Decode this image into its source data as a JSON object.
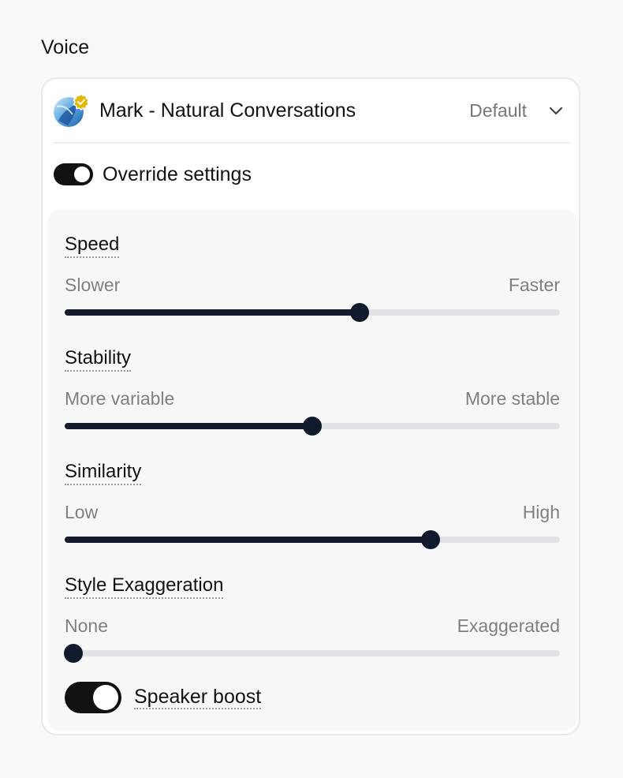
{
  "section": {
    "title": "Voice"
  },
  "voice": {
    "name": "Mark - Natural Conversations",
    "status": "Default",
    "avatar_icon": "voice-avatar-icon",
    "verified_icon": "verified-badge-icon",
    "dropdown_icon": "chevron-down-icon"
  },
  "override": {
    "label": "Override settings",
    "enabled": true
  },
  "sliders": [
    {
      "title": "Speed",
      "min_label": "Slower",
      "max_label": "Faster",
      "value": 0.596
    },
    {
      "title": "Stability",
      "min_label": "More variable",
      "max_label": "More stable",
      "value": 0.5
    },
    {
      "title": "Similarity",
      "min_label": "Low",
      "max_label": "High",
      "value": 0.739
    },
    {
      "title": "Style Exaggeration",
      "min_label": "None",
      "max_label": "Exaggerated",
      "value": 0.018
    }
  ],
  "speaker_boost": {
    "label": "Speaker boost",
    "enabled": true
  },
  "colors": {
    "accent": "#111a2c",
    "track": "#e2e2e6",
    "panel": "#f8f8f8",
    "verified": "#e5b800"
  }
}
